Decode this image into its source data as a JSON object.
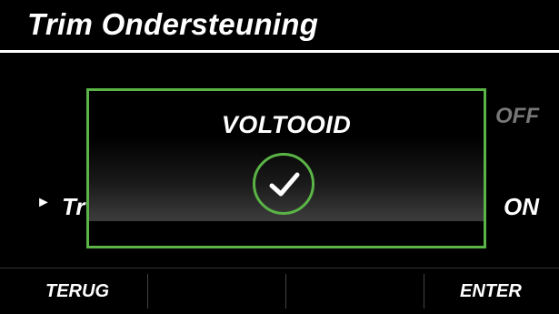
{
  "header": {
    "title": "Trim Ondersteuning"
  },
  "list": {
    "off_label": "OFF",
    "row": {
      "label": "Tr",
      "value": "ON"
    }
  },
  "dialog": {
    "title": "VOLTOOID",
    "icon": "checkmark-icon"
  },
  "footer": {
    "back_label": "TERUG",
    "enter_label": "ENTER"
  },
  "colors": {
    "accent": "#5ab446",
    "background": "#000000",
    "text": "#ffffff",
    "muted": "#777777"
  }
}
